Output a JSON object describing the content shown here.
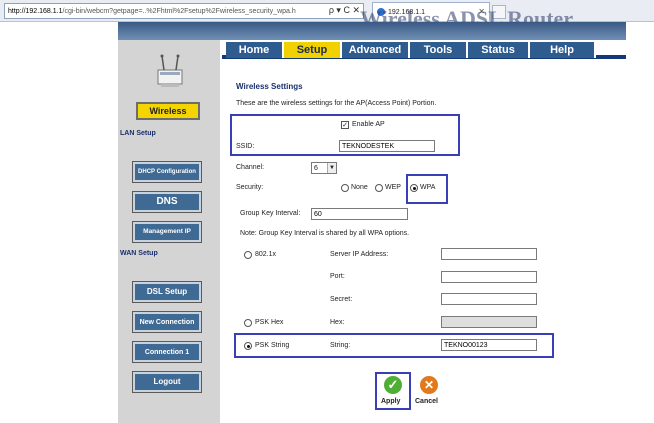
{
  "browser": {
    "url": "http://192.168.1.1/cgi-bin/webcm?getpage=..%2Fhtml%2Fsetup%2Fwireless_security_wpa.h",
    "url_host": "http://192.168.1.1",
    "url_rest": "/cgi-bin/webcm?getpage=..%2Fhtml%2Fsetup%2Fwireless_security_wpa.h",
    "url_icons": "ρ ▾ C ✕",
    "tab_title": "192.168.1.1",
    "tab_close": "✕",
    "brand_text": "Wireless ADSL Router"
  },
  "nav_tabs": [
    "Home",
    "Setup",
    "Advanced",
    "Tools",
    "Status",
    "Help"
  ],
  "active_tab": "Setup",
  "sidebar": {
    "wireless": "Wireless",
    "lan_setup": "LAN Setup",
    "dhcp": "DHCP Configuration",
    "dns": "DNS",
    "management_ip": "Management IP",
    "wan_setup": "WAN Setup",
    "dsl_setup": "DSL Setup",
    "new_connection": "New Connection",
    "connection_1": "Connection 1",
    "logout": "Logout"
  },
  "form": {
    "heading": "Wireless Settings",
    "description": "These are the wireless settings for the AP(Access Point) Portion.",
    "enable_ap_label": "Enable AP",
    "enable_ap_checked": true,
    "ssid_label": "SSID:",
    "ssid_value": "TEKNODESTEK",
    "channel_label": "Channel:",
    "channel_value": "6",
    "security_label": "Security:",
    "security_options": [
      "None",
      "WEP",
      "WPA"
    ],
    "security_selected": "WPA",
    "group_key_label": "Group Key Interval:",
    "group_key_value": "60",
    "note": "Note: Group Key Interval is shared by all WPA options.",
    "auth_8021x": "802.1x",
    "server_ip_label": "Server IP Address:",
    "port_label": "Port:",
    "secret_label": "Secret:",
    "psk_hex": "PSK Hex",
    "hex_label": "Hex:",
    "psk_string": "PSK String",
    "string_label": "String:",
    "string_value": "TEKNO00123",
    "psk_selected": "PSK String",
    "apply_label": "Apply",
    "cancel_label": "Cancel"
  },
  "colors": {
    "accent_blue": "#2f5c8e",
    "active_yellow": "#f2d100",
    "highlight_box": "#3a3fb5",
    "apply_green": "#4fae35",
    "cancel_orange": "#e07a1c"
  }
}
